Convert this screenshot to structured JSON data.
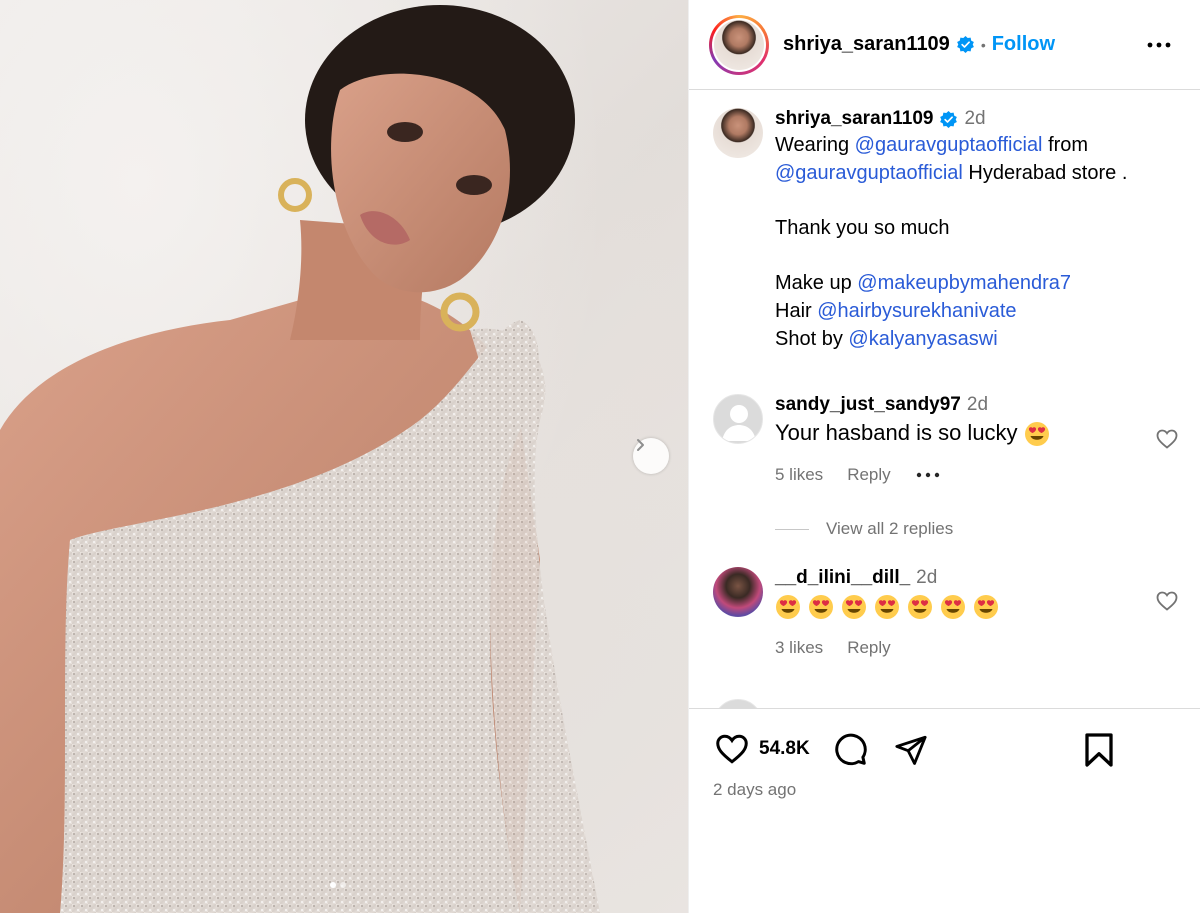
{
  "post": {
    "username": "shriya_saran1109",
    "follow_label": "Follow",
    "separator": "•"
  },
  "caption": {
    "username": "shriya_saran1109",
    "time": "2d",
    "line1_a": "Wearing ",
    "line1_mention": "@gauravguptaofficial",
    "line1_b": " from",
    "line2_mention": "@gauravguptaofficial",
    "line2_b": " Hyderabad store .",
    "line3": "Thank you so much",
    "makeup_label": "Make up ",
    "makeup_mention": "@makeupbymahendra7",
    "hair_label": "Hair ",
    "hair_mention": "@hairbysurekhanivate",
    "shot_label": "Shot by ",
    "shot_mention": "@kalyanyasaswi"
  },
  "comments": [
    {
      "username": "sandy_just_sandy97",
      "time": "2d",
      "text": "Your hasband is so lucky",
      "emoji_count": 1,
      "likes": "5 likes",
      "reply": "Reply",
      "view_replies": "View all 2 replies"
    },
    {
      "username": "__d_ilini__dill_",
      "time": "2d",
      "text": "",
      "emoji_count": 7,
      "likes": "3 likes",
      "reply": "Reply"
    }
  ],
  "actions": {
    "like_count": "54.8K",
    "posted": "2 days ago"
  },
  "carousel": {
    "slides": 2,
    "active_index": 0
  },
  "colors": {
    "follow": "#0095f6",
    "mention": "#2a5bd7",
    "secondary_text": "#737373",
    "verified": "#0095f6"
  },
  "icons": [
    "verified-badge-icon",
    "more-options-icon",
    "heart-icon",
    "comment-icon",
    "share-icon",
    "bookmark-icon",
    "chevron-right-icon",
    "heart-eyes-emoji"
  ]
}
